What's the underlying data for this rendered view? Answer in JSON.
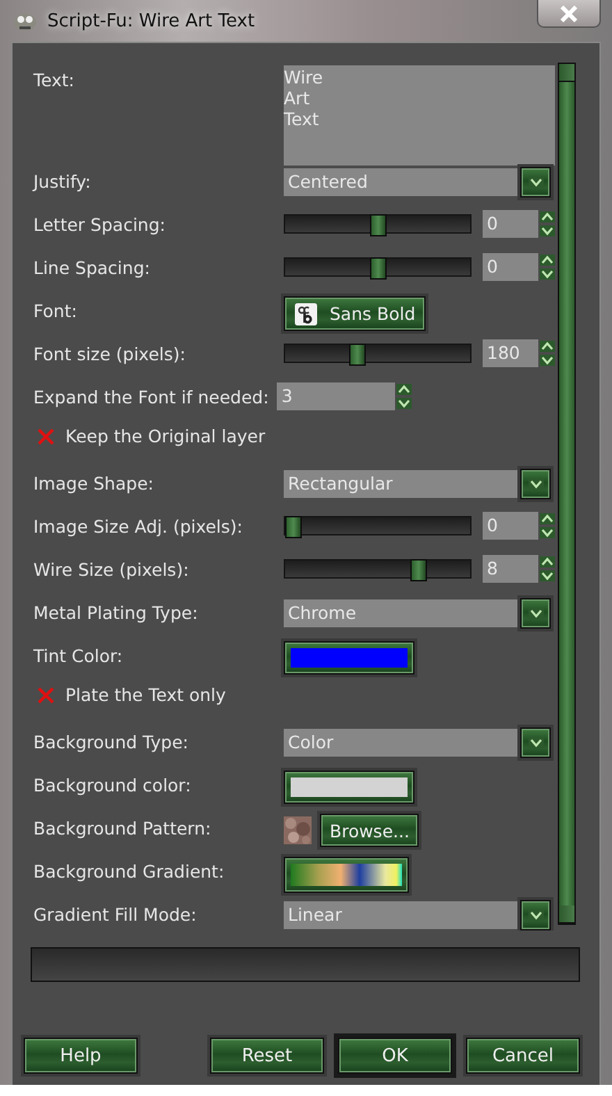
{
  "window": {
    "title": "Script-Fu: Wire Art Text"
  },
  "fields": [
    {
      "kind": "text",
      "label": "Text:",
      "lines": [
        "Wire",
        "Art",
        "Text"
      ]
    },
    {
      "kind": "combo",
      "label": "Justify:",
      "value": "Centered"
    },
    {
      "kind": "slider",
      "label": "Letter Spacing:",
      "level": 0.5,
      "value": "0"
    },
    {
      "kind": "slider",
      "label": "Line Spacing:",
      "level": 0.5,
      "value": "0"
    },
    {
      "kind": "font",
      "label": "Font:",
      "value": "Sans Bold"
    },
    {
      "kind": "slider",
      "label": "Font size (pixels):",
      "level": 0.38,
      "value": "180"
    },
    {
      "kind": "spin",
      "label": "Expand the Font if needed:",
      "value": "3"
    },
    {
      "kind": "toggle",
      "label": "Keep the Original layer",
      "checked": false
    },
    {
      "kind": "combo",
      "label": "Image Shape:",
      "value": "Rectangular"
    },
    {
      "kind": "slider",
      "label": "Image Size Adj. (pixels):",
      "level": 0,
      "value": "0"
    },
    {
      "kind": "slider",
      "label": "Wire Size (pixels):",
      "level": 0.74,
      "value": "8"
    },
    {
      "kind": "combo",
      "label": "Metal Plating Type:",
      "value": "Chrome"
    },
    {
      "kind": "color",
      "label": "Tint Color:",
      "color": "#0000ff"
    },
    {
      "kind": "toggle",
      "label": "Plate the Text only",
      "checked": false
    },
    {
      "kind": "combo",
      "label": "Background Type:",
      "value": "Color"
    },
    {
      "kind": "color",
      "label": "Background color:",
      "color": "#d3d3d3"
    },
    {
      "kind": "pattern",
      "label": "Background Pattern:",
      "button": "Browse..."
    },
    {
      "kind": "gradient",
      "label": "Background Gradient:"
    },
    {
      "kind": "combo",
      "label": "Gradient Fill Mode:",
      "value": "Linear"
    }
  ],
  "progress": {
    "level": 0
  },
  "buttons": [
    {
      "label": "Help",
      "default": false
    },
    {
      "label": "Reset",
      "default": false
    },
    {
      "label": "OK",
      "default": true
    },
    {
      "label": "Cancel",
      "default": false
    }
  ]
}
